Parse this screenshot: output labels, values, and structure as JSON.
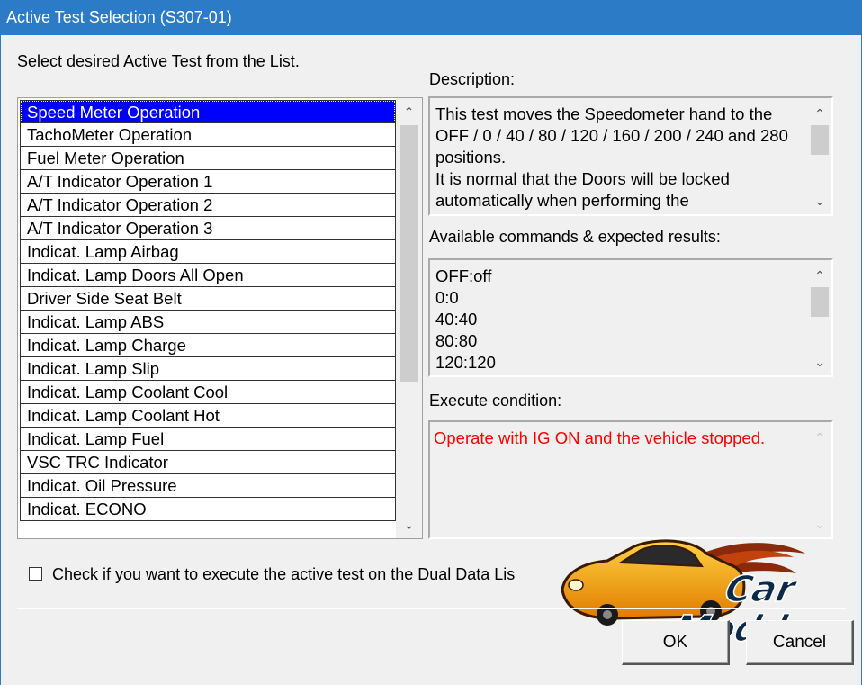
{
  "window": {
    "title": "Active Test Selection (S307-01)"
  },
  "list_prompt": "Select desired Active Test from the List.",
  "tests": [
    "Speed Meter Operation",
    "TachoMeter Operation",
    "Fuel Meter Operation",
    "A/T Indicator Operation 1",
    "A/T Indicator Operation 2",
    "A/T Indicator Operation 3",
    "Indicat. Lamp Airbag",
    "Indicat. Lamp Doors All Open",
    "Driver Side Seat Belt",
    "Indicat. Lamp ABS",
    "Indicat. Lamp Charge",
    "Indicat. Lamp Slip",
    "Indicat. Lamp Coolant Cool",
    "Indicat. Lamp Coolant Hot",
    "Indicat. Lamp Fuel",
    "VSC TRC Indicator",
    "Indicat. Oil Pressure",
    "Indicat. ECONO"
  ],
  "selected_test": "Speed Meter Operation",
  "description": {
    "label": "Description:",
    "text": "This test moves the Speedometer hand to the OFF / 0 / 40 / 80 / 120 / 160 / 200 / 240 and 280 positions.\nIt is normal that the Doors will be locked automatically when performing the"
  },
  "commands": {
    "label": "Available commands & expected results:",
    "lines": [
      "OFF:off",
      "0:0",
      "40:40",
      "80:80",
      "120:120"
    ]
  },
  "execute_condition": {
    "label": "Execute condition:",
    "text": "Operate with IG ON and the vehicle stopped."
  },
  "dual_data_checkbox": {
    "label": "Check if you want to execute the active test on the Dual Data Lis",
    "checked": false
  },
  "buttons": {
    "ok": "OK",
    "cancel": "Cancel"
  },
  "watermark": {
    "text": "Car Modder"
  },
  "colors": {
    "titlebar": "#2b7bc7",
    "selection": "#0000ff",
    "condition_text": "#ff0000"
  },
  "icons": {
    "scroll_up": "chevron-up-icon",
    "scroll_down": "chevron-down-icon",
    "logo": "car-modder-logo"
  }
}
